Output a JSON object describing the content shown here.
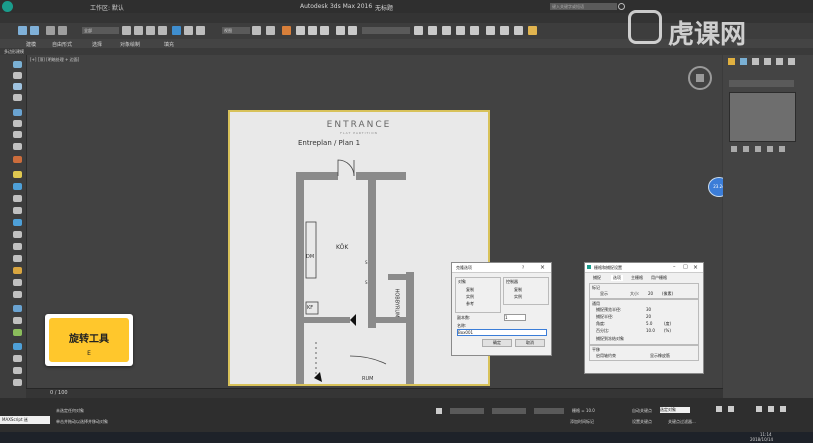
{
  "window": {
    "title": "Autodesk 3ds Max 2016",
    "tab_label": "无标题",
    "search_placeholder": "键入关键字或短语",
    "workspace": "工作区: 默认"
  },
  "menu": [],
  "toolbar": {
    "view_dropdown": "视图",
    "selection_set": ""
  },
  "ribbon": {
    "tabs": [
      "建模",
      "自由形式",
      "选择",
      "对象绘制",
      "填充"
    ],
    "subtitle": "多边形建模"
  },
  "viewport": {
    "label": "[+] [顶] [明暗处理 + 边面]"
  },
  "plan": {
    "logo": "ENTRANCE",
    "logo_sub": "FLAT PARTITION",
    "title": "Entreplan / Plan 1",
    "rooms": [
      "KÖK",
      "DM",
      "KF",
      "HOBBYRUM",
      "RUM"
    ],
    "marks": [
      "S",
      "S"
    ]
  },
  "dialog_clone": {
    "title": "克隆选项",
    "group_object": "对象",
    "opt_copy": "复制",
    "opt_instance": "实例",
    "opt_reference": "参考",
    "group_controller": "控制器",
    "ctrl_copy": "复制",
    "ctrl_instance": "实例",
    "count_label": "副本数:",
    "count_value": "1",
    "name_label": "名称:",
    "name_value": "Box001",
    "ok": "确定",
    "cancel": "取消",
    "help": "?"
  },
  "dialog_snap": {
    "title": "栅格和捕捉设置",
    "tabs": [
      "捕捉",
      "选项",
      "主栅格",
      "用户栅格"
    ],
    "group_marker": "标记",
    "marker_show": "显示",
    "marker_size_label": "大小:",
    "marker_size": "20",
    "unit": "(像素)",
    "group_general": "通用",
    "snap_radius_label": "捕捉预览半径:",
    "snap_radius": "30",
    "snap_strength_label": "捕捉半径:",
    "snap_strength": "20",
    "angle_label": "角度:",
    "angle_value": "5.0",
    "unit_deg": "(度)",
    "percent_label": "百分比:",
    "percent_value": "10.0",
    "unit_pct": "(%)",
    "frozen": "捕捉到冻结对象",
    "group_translate": "平移",
    "axis_constraint": "启用轴约束",
    "rubber_band": "显示橡皮筋"
  },
  "badge": {
    "title": "旋转工具",
    "key": "E"
  },
  "status": {
    "frame": "0 / 100",
    "maxscript": "MAXScript 迷",
    "prompt1": "未选定任何对象",
    "prompt2": "单击并拖动以选择并移动对象",
    "grid": "栅格 = 10.0",
    "auto_key": "自动关键点",
    "selected": "选定对象",
    "set_key": "设置关键点",
    "key_filter": "关键点过滤器...",
    "add_time_tag": "添加时间标记"
  },
  "taskbar": {
    "time": "11:14",
    "date": "2018/10/14"
  },
  "watermark": {
    "text": "虎课网"
  },
  "float_badge": {
    "text": "23.24"
  },
  "colors": {
    "accent_yellow": "#ffc72c",
    "viewport_bg": "#424242",
    "plan_border": "#d8c25a",
    "dialog_bg": "#f0f0f0"
  }
}
